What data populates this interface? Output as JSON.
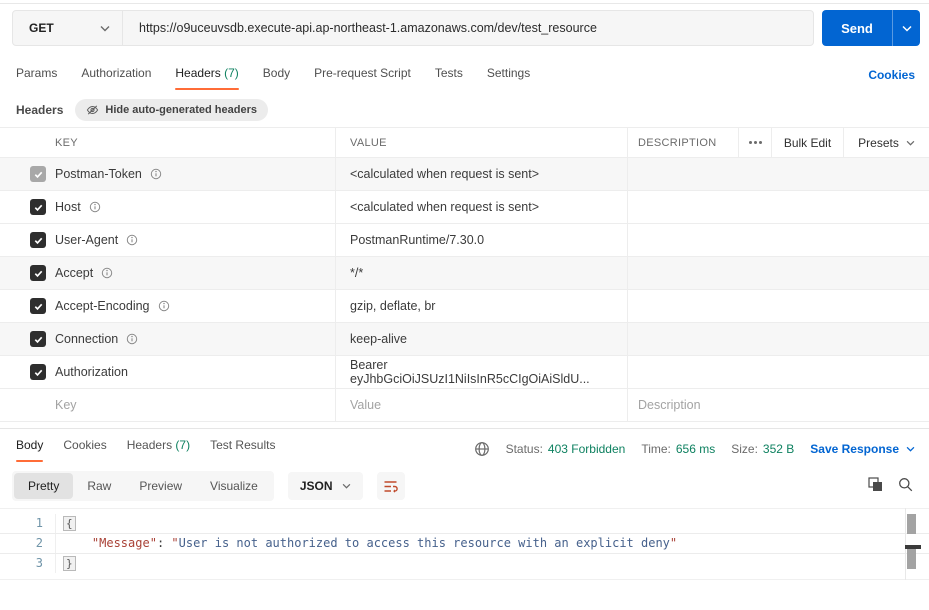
{
  "request": {
    "method": "GET",
    "url": "https://o9uceuvsdb.execute-api.ap-northeast-1.amazonaws.com/dev/test_resource",
    "send_label": "Send",
    "tabs": [
      {
        "label": "Params"
      },
      {
        "label": "Authorization"
      },
      {
        "label": "Headers",
        "count": "(7)"
      },
      {
        "label": "Body"
      },
      {
        "label": "Pre-request Script"
      },
      {
        "label": "Tests"
      },
      {
        "label": "Settings"
      }
    ],
    "cookies_link": "Cookies"
  },
  "headers_panel": {
    "title": "Headers",
    "hide_autogen_label": "Hide auto-generated headers"
  },
  "headers_table": {
    "col_key": "KEY",
    "col_value": "VALUE",
    "col_description": "DESCRIPTION",
    "bulk_edit_label": "Bulk Edit",
    "presets_label": "Presets",
    "rows": [
      {
        "key": "Postman-Token",
        "value": "<calculated when request is sent>",
        "checked": true,
        "disabled": true
      },
      {
        "key": "Host",
        "value": "<calculated when request is sent>",
        "checked": true
      },
      {
        "key": "User-Agent",
        "value": "PostmanRuntime/7.30.0",
        "checked": true
      },
      {
        "key": "Accept",
        "value": "*/*",
        "checked": true
      },
      {
        "key": "Accept-Encoding",
        "value": "gzip, deflate, br",
        "checked": true
      },
      {
        "key": "Connection",
        "value": "keep-alive",
        "checked": true
      },
      {
        "key": "Authorization",
        "value": "Bearer eyJhbGciOiJSUzI1NiIsInR5cCIgOiAiSldU...",
        "checked": true
      }
    ],
    "placeholder_row": {
      "key": "Key",
      "value": "Value",
      "description": "Description"
    }
  },
  "response": {
    "tabs": [
      {
        "label": "Body"
      },
      {
        "label": "Cookies"
      },
      {
        "label": "Headers",
        "count": "(7)"
      },
      {
        "label": "Test Results"
      }
    ],
    "status_label": "Status:",
    "status_value": "403 Forbidden",
    "time_label": "Time:",
    "time_value": "656 ms",
    "size_label": "Size:",
    "size_value": "352 B",
    "save_response_label": "Save Response",
    "view_modes": [
      {
        "label": "Pretty"
      },
      {
        "label": "Raw"
      },
      {
        "label": "Preview"
      },
      {
        "label": "Visualize"
      }
    ],
    "format_selected": "JSON",
    "body_json": {
      "line_numbers": [
        "1",
        "2",
        "3"
      ],
      "open_brace": "{",
      "indent": "    ",
      "key": "\"Message\"",
      "colon": ": ",
      "quote": "\"",
      "value_text": "User is not authorized to access this resource with an explicit deny",
      "close_brace": "}"
    }
  },
  "colors": {
    "accent_orange": "#ff6c37",
    "primary_blue": "#0265d2",
    "success_green": "#0e8160"
  }
}
